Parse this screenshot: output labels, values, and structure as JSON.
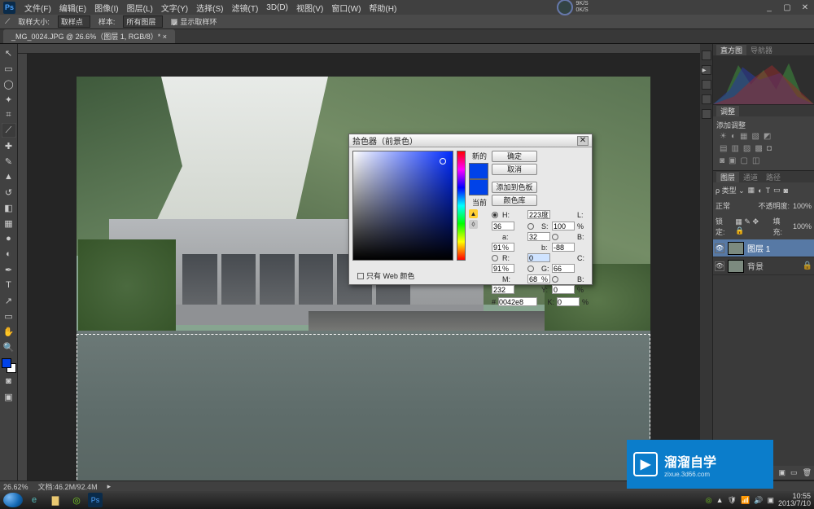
{
  "menu": {
    "items": [
      "文件(F)",
      "编辑(E)",
      "图像(I)",
      "图层(L)",
      "文字(Y)",
      "选择(S)",
      "滤镜(T)",
      "3D(D)",
      "视图(V)",
      "窗口(W)",
      "帮助(H)"
    ]
  },
  "options": {
    "label_size": "取样大小:",
    "size_value": "取样点",
    "label_sample": "样本:",
    "sample_value": "所有图层",
    "show_ring": "显示取样环"
  },
  "tab": {
    "title": "_MG_0024.JPG @ 26.6%（图层 1, RGB/8）*"
  },
  "badge": {
    "a": "9K/S",
    "b": "0K/S"
  },
  "panels": {
    "nav_tab1": "直方图",
    "nav_tab2": "导航器",
    "adjust_title": "调整",
    "adjust_sub": "添加调整",
    "layers_tab1": "图层",
    "layers_tab2": "通道",
    "layers_tab3": "路径",
    "blend_label": "正常",
    "opacity_label": "不透明度:",
    "opacity_value": "100%",
    "lock_label": "锁定:",
    "fill_label": "填充:",
    "fill_value": "100%",
    "layer1": "图层 1",
    "layer_bg": "背景"
  },
  "status": {
    "zoom": "26.62%",
    "docsize_label": "文档:",
    "docsize": "46.2M/92.4M"
  },
  "dialog": {
    "title": "拾色器（前景色）",
    "new_label": "新的",
    "cur_label": "当前",
    "ok": "确定",
    "cancel": "取消",
    "add_swatch": "添加到色板",
    "lib": "颜色库",
    "H": "223",
    "S": "100",
    "B1": "91",
    "R": "0",
    "G": "66",
    "B2": "232",
    "L": "36",
    "a": "32",
    "b": "-88",
    "C": "91",
    "M": "68",
    "Y": "0",
    "K": "0",
    "hex": "0042e8",
    "deg": "度",
    "pct": "%",
    "web_only": "只有 Web 颜色"
  },
  "brand": {
    "title": "溜溜自学",
    "sub": "zixue.3d66.com"
  },
  "taskbar": {
    "time": "10:55",
    "date": "2013/7/10"
  }
}
